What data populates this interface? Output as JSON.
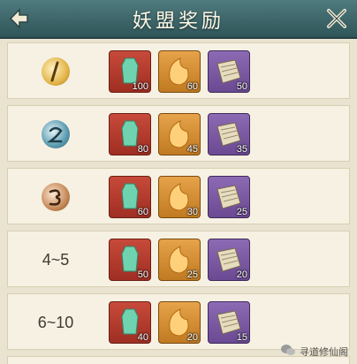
{
  "header": {
    "title": "妖盟奖励",
    "back_icon": "back-arrow-icon",
    "close_icon": "close-x-icon"
  },
  "rows": [
    {
      "rank": "",
      "medal": "gold-medal-1",
      "items": [
        {
          "qty": "100"
        },
        {
          "qty": "60"
        },
        {
          "qty": "50"
        }
      ]
    },
    {
      "rank": "",
      "medal": "silver-medal-2",
      "items": [
        {
          "qty": "80"
        },
        {
          "qty": "45"
        },
        {
          "qty": "35"
        }
      ]
    },
    {
      "rank": "",
      "medal": "bronze-medal-3",
      "items": [
        {
          "qty": "60"
        },
        {
          "qty": "30"
        },
        {
          "qty": "25"
        }
      ]
    },
    {
      "rank": "4~5",
      "medal": "",
      "items": [
        {
          "qty": "50"
        },
        {
          "qty": "25"
        },
        {
          "qty": "20"
        }
      ]
    },
    {
      "rank": "6~10",
      "medal": "",
      "items": [
        {
          "qty": "40"
        },
        {
          "qty": "20"
        },
        {
          "qty": "15"
        }
      ]
    }
  ],
  "watermark": {
    "text": "寻道修仙阁"
  },
  "colors": {
    "header": "#3f686b",
    "row_bg": "#f6f1e2",
    "gold": "#e3b54a",
    "silver": "#5a9bb0",
    "bronze": "#c78a58"
  }
}
